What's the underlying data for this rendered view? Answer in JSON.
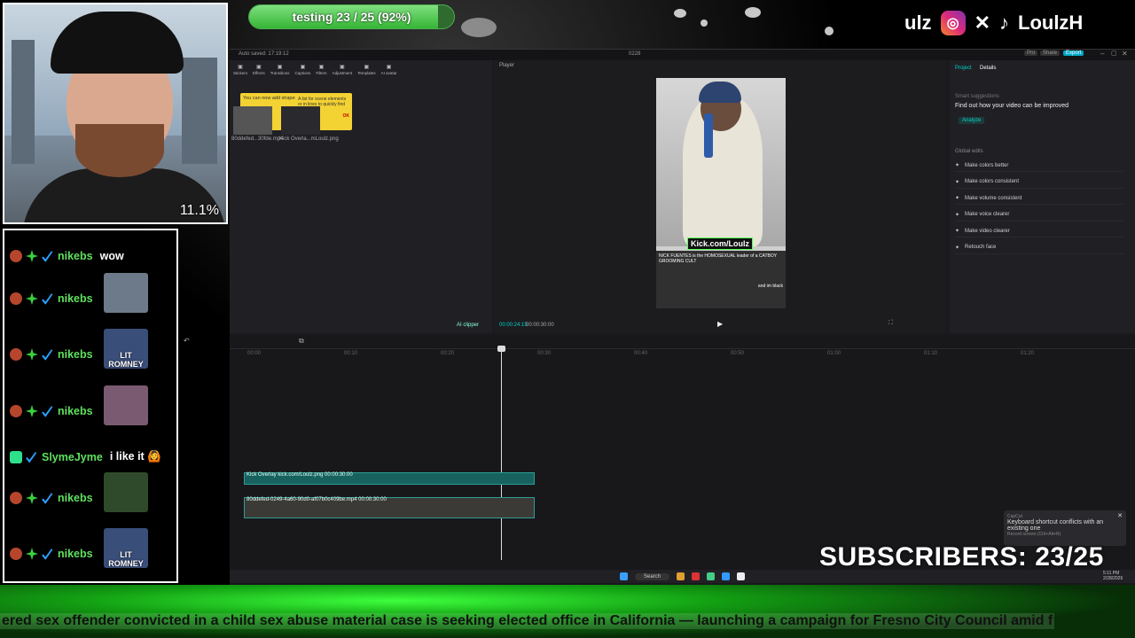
{
  "overlay": {
    "progress": {
      "label": "testing 23 / 25 (92%)",
      "fraction": 0.92
    },
    "webcam_percent": "11.1%",
    "handle_prefix": "ulz",
    "handle": "LoulzH",
    "subscribers": "SUBSCRIBERS: 23/25",
    "ticker": "ered sex offender convicted in a child sex abuse material case is seeking elected office in California — launching a campaign for Fresno City Council amid f"
  },
  "chat": {
    "messages": [
      {
        "user": "nikebs",
        "text": "wow",
        "emote": false
      },
      {
        "user": "nikebs",
        "text": "",
        "emote": true,
        "emote_name": "emote-man-at-desk"
      },
      {
        "user": "nikebs",
        "text": "",
        "emote": true,
        "emote_name": "emote-lit-romney",
        "emote_text": "LIT ROMNEY"
      },
      {
        "user": "nikebs",
        "text": "",
        "emote": true,
        "emote_name": "emote-face"
      },
      {
        "user": "SlymeJyme",
        "text": "i like it 🙆",
        "emote": false
      },
      {
        "user": "nikebs",
        "text": "",
        "emote": true,
        "emote_name": "emote-green-face"
      },
      {
        "user": "nikebs",
        "text": "",
        "emote": true,
        "emote_name": "emote-lit-romney",
        "emote_text": "LIT ROMNEY"
      }
    ]
  },
  "capcut": {
    "title": "0228",
    "autosave": "Auto saved: 17:19:12",
    "toolbar": [
      "Stickers",
      "Effects",
      "Transitions",
      "Captions",
      "Filters",
      "Adjustment",
      "Templates",
      "AI avatar"
    ],
    "tip1": "You can now add shapes to your video",
    "tip2": "A list for scene elements or in lines to quickly find clips.",
    "tip_ok": "OK",
    "media": [
      "80ddefed...30fde.mp4",
      "Kick Overla...mLoulz.png"
    ],
    "player_label": "Player",
    "video_overlay": {
      "kick": "Kick.com/Loulz",
      "chat_line1": "NICK FUENTES is the HOMOSEXUAL leader of a CATBOY GROOMING CULT",
      "chat_line2": "and im black"
    },
    "time_current": "00:00:24:15",
    "time_total": "00:00:30:00",
    "ai_clipper": "AI clipper",
    "right_tabs": [
      "Project",
      "Details"
    ],
    "smart_suggestions": "Smart suggestions",
    "improve_text": "Find out how your video can be improved",
    "analyze": "Analyze",
    "global_edits": "Global edits",
    "edits": [
      "Make colors better",
      "Make colors consistent",
      "Make volume consistent",
      "Make voice clearer",
      "Make video clearer",
      "Retouch face"
    ],
    "header_buttons": [
      "Pro",
      "Share",
      "Export"
    ],
    "track1_label": "Kick Overlay kick.com/Loulz.png  00:00:30:00",
    "track2_label": "80ddefed-0249-4a60-90d0-af07b0c409be.mp4  00:00:30:00",
    "ruler": [
      "00:00",
      "00:10",
      "00:20",
      "00:30",
      "00:40",
      "00:50",
      "01:00",
      "01:10",
      "01:20"
    ],
    "kb_popup_title": "CapCut",
    "kb_popup_text": "Keyboard shortcut conflicts with an existing one",
    "kb_popup_sub": "Record screen (Ctrl+Alt+R)"
  },
  "taskbar": {
    "search": "Search",
    "time": "5:11 PM",
    "date": "2/28/2026"
  },
  "colors": {
    "accent": "#00d2c8",
    "chat_user": "#5ee05e",
    "track": "#17615e"
  }
}
